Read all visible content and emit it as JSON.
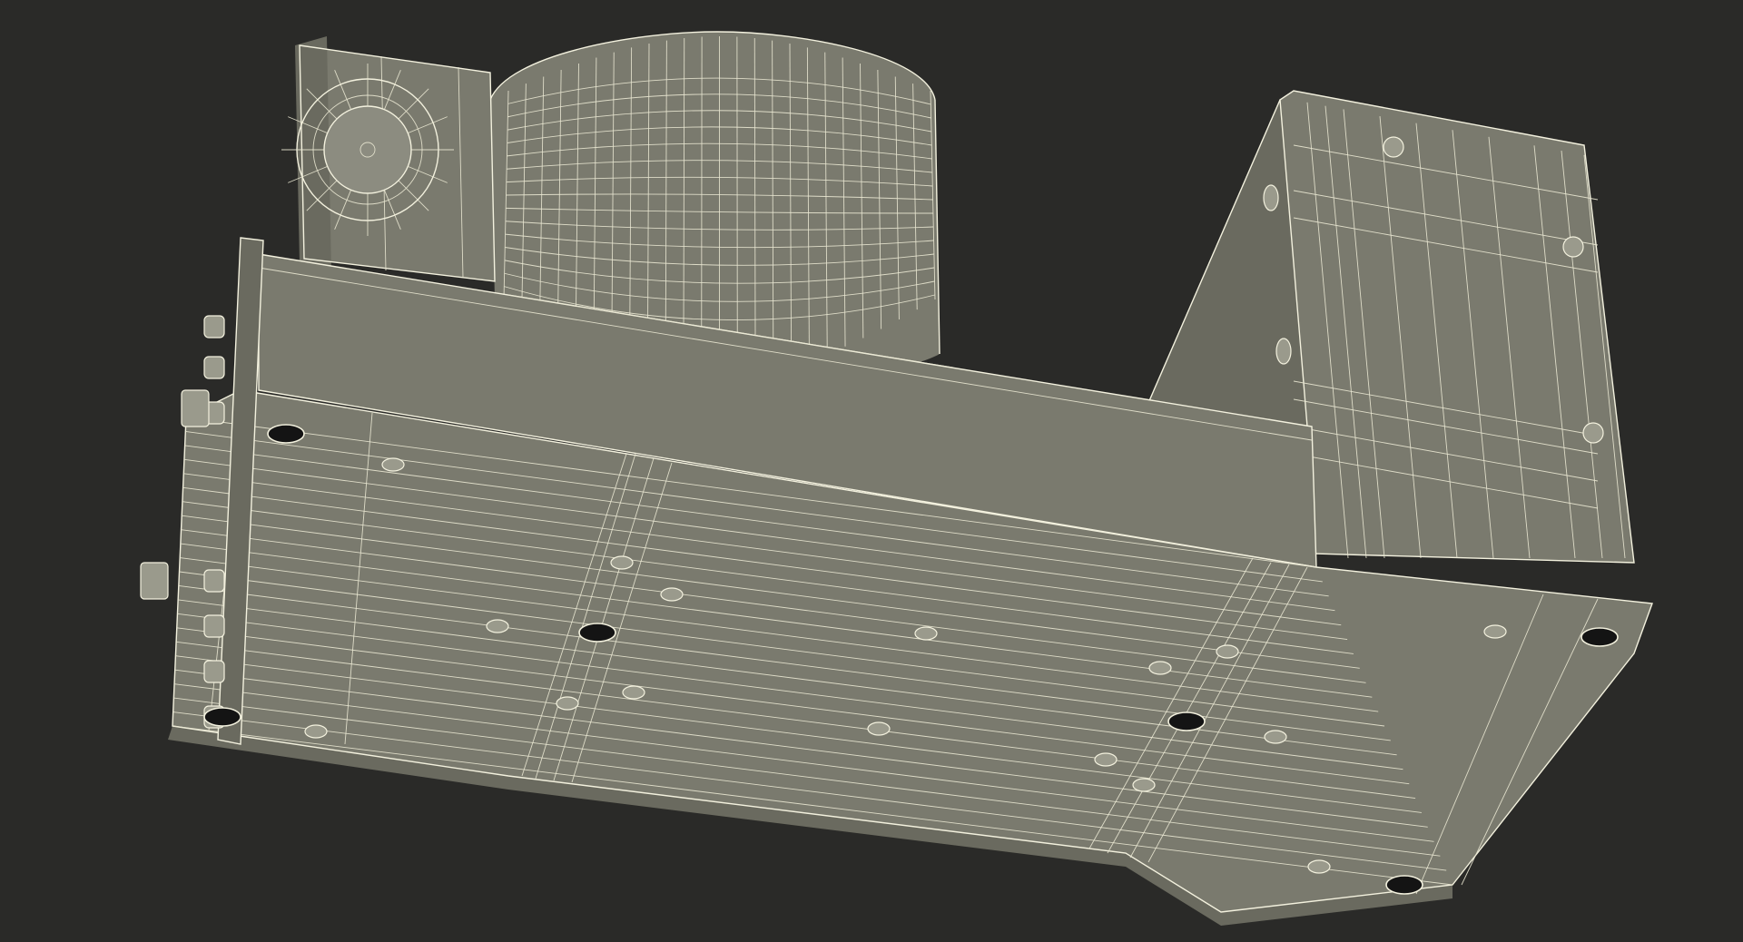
{
  "scene": {
    "subject": "wireframe-3d-model",
    "colors": {
      "background": "#2a2a28",
      "surface": "#7a7a6e",
      "wire": "#f3f1de"
    }
  }
}
